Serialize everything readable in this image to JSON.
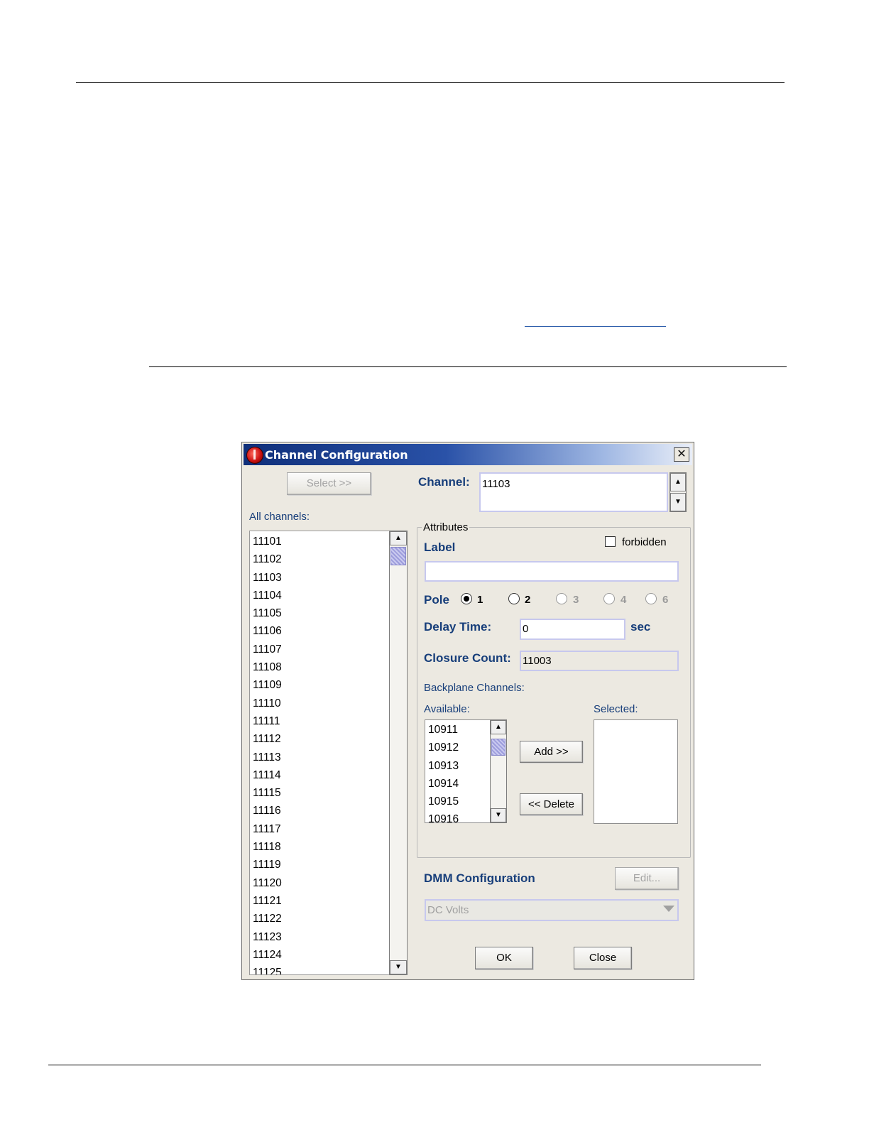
{
  "window": {
    "title": "Channel Configuration",
    "close_glyph": "✕"
  },
  "left": {
    "select_button": "Select >>",
    "all_channels_label": "All channels:",
    "channels": [
      "11101",
      "11102",
      "11103",
      "11104",
      "11105",
      "11106",
      "11107",
      "11108",
      "11109",
      "11110",
      "11111",
      "11112",
      "11113",
      "11114",
      "11115",
      "11116",
      "11117",
      "11118",
      "11119",
      "11120",
      "11121",
      "11122",
      "11123",
      "11124",
      "11125"
    ]
  },
  "channel": {
    "label": "Channel:",
    "value": "11103"
  },
  "attributes": {
    "group_title": "Attributes",
    "forbidden_label": "forbidden",
    "label_title": "Label",
    "label_value": "",
    "pole_label": "Pole",
    "pole_options": [
      {
        "label": "1",
        "selected": true,
        "enabled": true
      },
      {
        "label": "2",
        "selected": false,
        "enabled": true
      },
      {
        "label": "3",
        "selected": false,
        "enabled": false
      },
      {
        "label": "4",
        "selected": false,
        "enabled": false
      },
      {
        "label": "6",
        "selected": false,
        "enabled": false
      }
    ],
    "delay_label": "Delay Time:",
    "delay_value": "0",
    "delay_unit": "sec",
    "closure_label": "Closure Count:",
    "closure_value": "11003",
    "backplane_label": "Backplane Channels:",
    "available_label": "Available:",
    "selected_label": "Selected:",
    "available": [
      "10911",
      "10912",
      "10913",
      "10914",
      "10915",
      "10916"
    ],
    "selected": [],
    "add_button": "Add >>",
    "delete_button": "<< Delete"
  },
  "dmm": {
    "label": "DMM Configuration",
    "edit_button": "Edit...",
    "function_value": "DC Volts"
  },
  "footer": {
    "ok_button": "OK",
    "close_button": "Close"
  }
}
